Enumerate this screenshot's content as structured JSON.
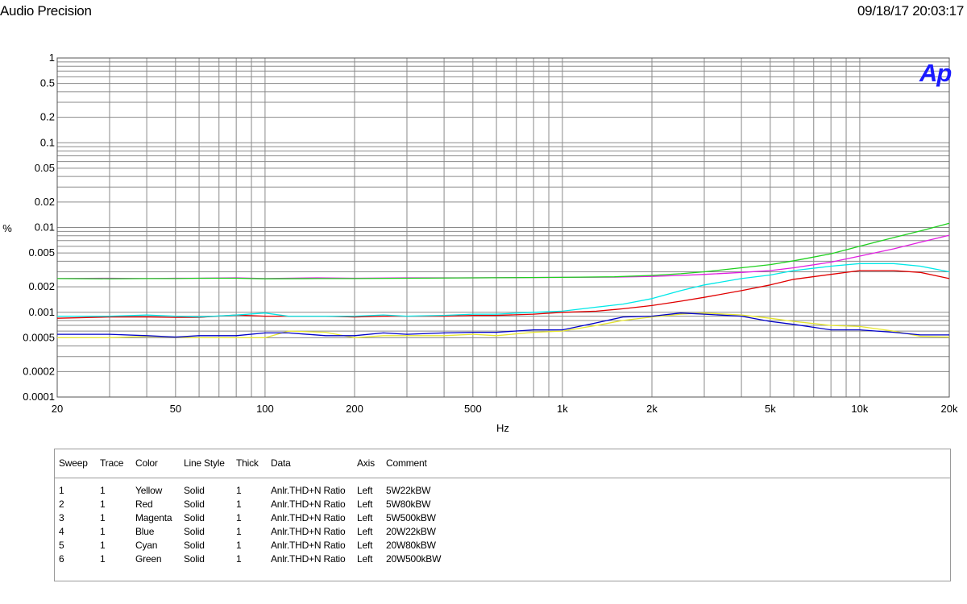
{
  "header": {
    "brand": "Audio Precision",
    "timestamp": "09/18/17 20:03:17"
  },
  "logo_text": "Ap",
  "chart_data": {
    "type": "line",
    "xscale": "log",
    "yscale": "log",
    "xlabel": "Hz",
    "ylabel": "%",
    "xlim": [
      20,
      20000
    ],
    "ylim": [
      0.0001,
      1
    ],
    "grid": true,
    "xticks": [
      {
        "v": 20,
        "label": "20"
      },
      {
        "v": 50,
        "label": "50"
      },
      {
        "v": 100,
        "label": "100"
      },
      {
        "v": 200,
        "label": "200"
      },
      {
        "v": 500,
        "label": "500"
      },
      {
        "v": 1000,
        "label": "1k"
      },
      {
        "v": 2000,
        "label": "2k"
      },
      {
        "v": 5000,
        "label": "5k"
      },
      {
        "v": 10000,
        "label": "10k"
      },
      {
        "v": 20000,
        "label": "20k"
      }
    ],
    "yticks": [
      {
        "v": 1,
        "label": "1"
      },
      {
        "v": 0.5,
        "label": "0.5"
      },
      {
        "v": 0.2,
        "label": "0.2"
      },
      {
        "v": 0.1,
        "label": "0.1"
      },
      {
        "v": 0.05,
        "label": "0.05"
      },
      {
        "v": 0.02,
        "label": "0.02"
      },
      {
        "v": 0.01,
        "label": "0.01"
      },
      {
        "v": 0.005,
        "label": "0.005"
      },
      {
        "v": 0.002,
        "label": "0.002"
      },
      {
        "v": 0.001,
        "label": "0.001"
      },
      {
        "v": 0.0005,
        "label": "0.0005"
      },
      {
        "v": 0.0002,
        "label": "0.0002"
      },
      {
        "v": 0.0001,
        "label": "0.0001"
      }
    ],
    "series": [
      {
        "name": "5W22kBW",
        "color": "#e6e62e",
        "x": [
          20,
          30,
          40,
          50,
          60,
          80,
          100,
          120,
          160,
          200,
          250,
          300,
          400,
          500,
          600,
          800,
          1000,
          1300,
          1600,
          2000,
          2500,
          3000,
          4000,
          5000,
          6000,
          8000,
          10000,
          13000,
          16000,
          20000
        ],
        "y": [
          0.0005,
          0.0005,
          0.00052,
          0.00051,
          0.0005,
          0.0005,
          0.0005,
          0.0006,
          0.00058,
          0.0005,
          0.00053,
          0.00053,
          0.00053,
          0.00055,
          0.00053,
          0.00058,
          0.0006,
          0.0007,
          0.0008,
          0.00088,
          0.00095,
          0.00098,
          0.00093,
          0.00085,
          0.00078,
          0.0007,
          0.00068,
          0.0006,
          0.00052,
          0.00051
        ]
      },
      {
        "name": "5W80kBW",
        "color": "#e00000",
        "x": [
          20,
          30,
          40,
          50,
          60,
          80,
          100,
          120,
          160,
          200,
          250,
          300,
          400,
          500,
          600,
          800,
          1000,
          1300,
          1600,
          2000,
          2500,
          3000,
          4000,
          5000,
          6000,
          8000,
          10000,
          13000,
          16000,
          20000
        ],
        "y": [
          0.00085,
          0.00088,
          0.00088,
          0.00087,
          0.00087,
          0.00093,
          0.0009,
          0.0009,
          0.0009,
          0.00088,
          0.0009,
          0.0009,
          0.0009,
          0.00092,
          0.00092,
          0.00095,
          0.001,
          0.00103,
          0.0011,
          0.0012,
          0.00135,
          0.0015,
          0.0018,
          0.0021,
          0.00245,
          0.0028,
          0.0031,
          0.0031,
          0.00295,
          0.0025
        ]
      },
      {
        "name": "5W500kBW",
        "color": "#e020e0",
        "x": [
          20,
          30,
          40,
          50,
          60,
          80,
          100,
          150,
          200,
          300,
          500,
          1000,
          1500,
          2000,
          2500,
          3000,
          4000,
          5000,
          6000,
          8000,
          10000,
          13000,
          16000,
          20000
        ],
        "y": [
          0.0025,
          0.00252,
          0.0025,
          0.00252,
          0.00252,
          0.00255,
          0.0025,
          0.00255,
          0.00252,
          0.00255,
          0.00255,
          0.00258,
          0.0026,
          0.00265,
          0.00272,
          0.0028,
          0.00295,
          0.0031,
          0.00335,
          0.0039,
          0.0046,
          0.0056,
          0.0067,
          0.0081
        ]
      },
      {
        "name": "20W22kBW",
        "color": "#0000c8",
        "x": [
          20,
          30,
          40,
          50,
          60,
          80,
          100,
          120,
          160,
          200,
          250,
          300,
          400,
          500,
          600,
          800,
          1000,
          1300,
          1600,
          2000,
          2500,
          3000,
          4000,
          5000,
          6000,
          8000,
          10000,
          13000,
          16000,
          20000
        ],
        "y": [
          0.00055,
          0.00055,
          0.00053,
          0.00051,
          0.00053,
          0.00053,
          0.00057,
          0.00057,
          0.00053,
          0.00053,
          0.00057,
          0.00055,
          0.00057,
          0.00058,
          0.00058,
          0.00062,
          0.00062,
          0.00075,
          0.00088,
          0.0009,
          0.00098,
          0.00095,
          0.0009,
          0.00078,
          0.00072,
          0.00062,
          0.00062,
          0.00058,
          0.00054,
          0.00054
        ]
      },
      {
        "name": "20W80kBW",
        "color": "#00e8e8",
        "x": [
          20,
          30,
          40,
          50,
          60,
          80,
          100,
          120,
          160,
          200,
          250,
          300,
          400,
          500,
          600,
          800,
          1000,
          1300,
          1600,
          2000,
          2500,
          3000,
          4000,
          5000,
          6000,
          8000,
          10000,
          13000,
          16000,
          20000
        ],
        "y": [
          0.0009,
          0.0009,
          0.00093,
          0.0009,
          0.00088,
          0.00093,
          0.00098,
          0.0009,
          0.0009,
          0.0009,
          0.00093,
          0.0009,
          0.00092,
          0.00095,
          0.00095,
          0.001,
          0.00103,
          0.00115,
          0.00125,
          0.00145,
          0.0018,
          0.0021,
          0.0025,
          0.00275,
          0.0031,
          0.0035,
          0.00375,
          0.00375,
          0.0035,
          0.003
        ]
      },
      {
        "name": "20W500kBW",
        "color": "#20d020",
        "x": [
          20,
          30,
          40,
          50,
          60,
          80,
          100,
          150,
          200,
          300,
          500,
          1000,
          1500,
          2000,
          2500,
          3000,
          4000,
          5000,
          6000,
          8000,
          10000,
          13000,
          16000,
          20000
        ],
        "y": [
          0.0025,
          0.00248,
          0.0025,
          0.0025,
          0.00252,
          0.00252,
          0.00248,
          0.0025,
          0.0025,
          0.00252,
          0.00255,
          0.00258,
          0.00262,
          0.00272,
          0.00285,
          0.003,
          0.00335,
          0.00365,
          0.00405,
          0.0049,
          0.006,
          0.0076,
          0.0091,
          0.0112
        ]
      }
    ]
  },
  "legend_table": {
    "headers": [
      "Sweep",
      "Trace",
      "Color",
      "Line Style",
      "Thick",
      "Data",
      "Axis",
      "Comment"
    ],
    "rows": [
      [
        "1",
        "1",
        "Yellow",
        "Solid",
        "1",
        "Anlr.THD+N Ratio",
        "Left",
        "5W22kBW"
      ],
      [
        "2",
        "1",
        "Red",
        "Solid",
        "1",
        "Anlr.THD+N Ratio",
        "Left",
        "5W80kBW"
      ],
      [
        "3",
        "1",
        "Magenta",
        "Solid",
        "1",
        "Anlr.THD+N Ratio",
        "Left",
        "5W500kBW"
      ],
      [
        "4",
        "1",
        "Blue",
        "Solid",
        "1",
        "Anlr.THD+N Ratio",
        "Left",
        "20W22kBW"
      ],
      [
        "5",
        "1",
        "Cyan",
        "Solid",
        "1",
        "Anlr.THD+N Ratio",
        "Left",
        "20W80kBW"
      ],
      [
        "6",
        "1",
        "Green",
        "Solid",
        "1",
        "Anlr.THD+N Ratio",
        "Left",
        "20W500kBW"
      ]
    ]
  }
}
